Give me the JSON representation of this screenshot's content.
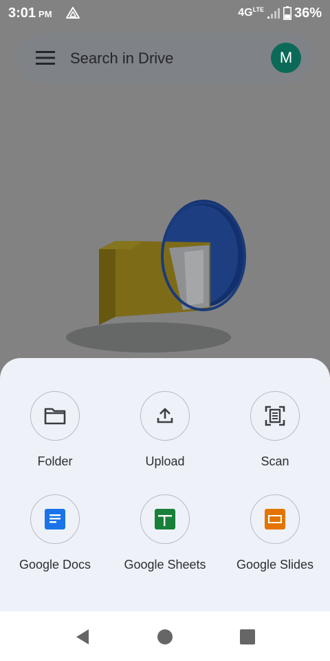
{
  "status": {
    "time": "3:01",
    "ampm": "PM",
    "network": "4G",
    "network_sub": "LTE",
    "battery": "36%"
  },
  "search": {
    "placeholder": "Search in Drive",
    "avatar_initial": "M"
  },
  "create_sheet": {
    "items": [
      {
        "label": "Folder",
        "icon": "folder-icon"
      },
      {
        "label": "Upload",
        "icon": "upload-icon"
      },
      {
        "label": "Scan",
        "icon": "scan-icon"
      },
      {
        "label": "Google Docs",
        "icon": "google-docs-icon"
      },
      {
        "label": "Google Sheets",
        "icon": "google-sheets-icon"
      },
      {
        "label": "Google Slides",
        "icon": "google-slides-icon"
      }
    ]
  },
  "nav": {
    "back": "back-icon",
    "home": "home-icon",
    "recents": "recents-icon"
  },
  "colors": {
    "avatar": "#0a6a57",
    "docs": "#1a73e8",
    "sheets": "#188038",
    "slides": "#e37400",
    "sheet_bg": "#eef2f8"
  }
}
